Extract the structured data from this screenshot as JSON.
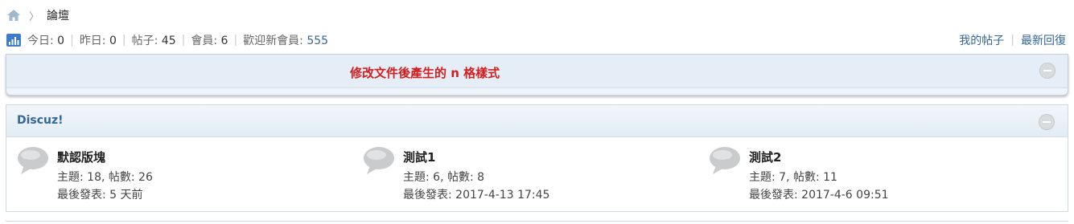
{
  "breadcrumb": {
    "home_icon": "home-icon",
    "separator": "〉",
    "current": "論壇"
  },
  "stats": {
    "icon": "bar-chart-icon",
    "today_label": "今日:",
    "today_value": "0",
    "yesterday_label": "昨日:",
    "yesterday_value": "0",
    "posts_label": "帖子:",
    "posts_value": "45",
    "members_label": "會員:",
    "members_value": "6",
    "welcome_label": "歡迎新會員:",
    "welcome_value": "555"
  },
  "top_links": {
    "my_posts": "我的帖子",
    "latest_replies": "最新回復"
  },
  "notice": {
    "text": "修改文件後產生的 n 格樣式"
  },
  "category": {
    "title": "Discuz!",
    "boards": [
      {
        "name": "默認版塊",
        "stats": "主題: 18, 帖數: 26",
        "last_post": "最後發表: 5 天前"
      },
      {
        "name": "測試1",
        "stats": "主題: 6, 帖數: 8",
        "last_post": "最後發表: 2017-4-13 17:45"
      },
      {
        "name": "測試2",
        "stats": "主題: 7, 帖數: 11",
        "last_post": "最後發表: 2017-4-6 09:51"
      }
    ]
  },
  "colors": {
    "link": "#336699",
    "notice_red": "#d21e1e",
    "header_bg": "#e5eef7"
  }
}
